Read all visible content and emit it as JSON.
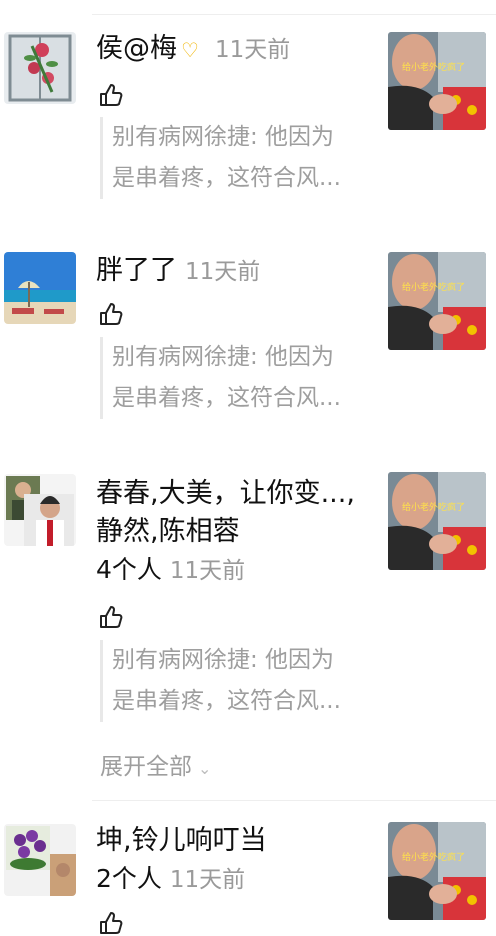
{
  "comments": [
    {
      "name": "侯@梅",
      "time": "11天前",
      "quote_line1": "别有病网徐捷: 他因为",
      "quote_line2": "是串着疼，这符合风..."
    },
    {
      "name": "胖了了",
      "time": "11天前",
      "quote_line1": "别有病网徐捷: 他因为",
      "quote_line2": "是串着疼，这符合风..."
    },
    {
      "name_line1": "春春,大美，让你变...,",
      "name_line2": "静然,陈相蓉",
      "count": "4个人",
      "time": "11天前",
      "quote_line1": "别有病网徐捷: 他因为",
      "quote_line2": "是串着疼，这符合风...",
      "expand": "展开全部"
    },
    {
      "name": "坤,铃儿响叮当",
      "count": "2个人",
      "time": "11天前"
    }
  ],
  "thumb_caption": "给小老外吃疯了",
  "icons": {
    "like": "thumbs-up-icon",
    "heart": "heart-badge-icon",
    "chevron": "chevron-down-icon"
  },
  "colors": {
    "time": "#9a9a9a",
    "quote": "#9e9e9e",
    "badge": "#f0b400"
  }
}
